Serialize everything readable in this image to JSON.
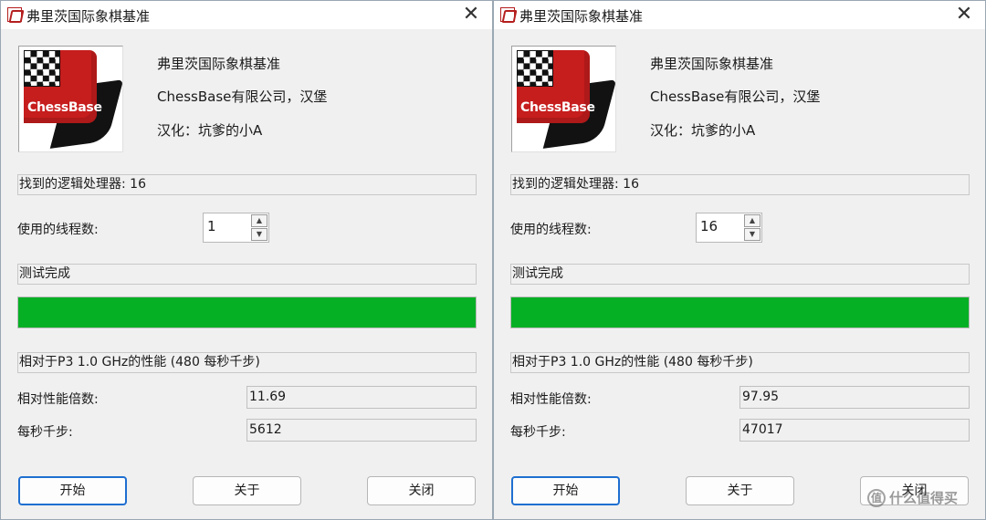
{
  "left": {
    "title": "弗里茨国际象棋基准",
    "close_glyph": "✕",
    "logo_word": "ChessBase",
    "info": [
      "弗里茨国际象棋基准",
      "ChessBase有限公司，汉堡",
      "汉化：坑爹的小A"
    ],
    "processors_text": "找到的逻辑处理器: 16",
    "threads_label": "使用的线程数:",
    "threads_value": "1",
    "status_text": "测试完成",
    "progress": 1.0,
    "perf_text": "相对于P3 1.0 GHz的性能 (480 每秒千步)",
    "factor_label": "相对性能倍数:",
    "factor_value": "11.69",
    "knps_label": "每秒千步:",
    "knps_value": "5612",
    "buttons": {
      "start": "开始",
      "about": "关于",
      "close": "关闭"
    }
  },
  "right": {
    "title": "弗里茨国际象棋基准",
    "close_glyph": "✕",
    "logo_word": "ChessBase",
    "info": [
      "弗里茨国际象棋基准",
      "ChessBase有限公司，汉堡",
      "汉化：坑爹的小A"
    ],
    "processors_text": "找到的逻辑处理器: 16",
    "threads_label": "使用的线程数:",
    "threads_value": "16",
    "status_text": "测试完成",
    "progress": 1.0,
    "perf_text": "相对于P3 1.0 GHz的性能 (480 每秒千步)",
    "factor_label": "相对性能倍数:",
    "factor_value": "97.95",
    "knps_label": "每秒千步:",
    "knps_value": "47017",
    "buttons": {
      "start": "开始",
      "about": "关于",
      "close": "关闭"
    }
  },
  "watermark": {
    "icon_glyph": "值",
    "text": "什么值得买"
  },
  "colors": {
    "progress_fill": "#06b025",
    "logo_red": "#c61d1d",
    "default_button_border": "#1f6fd1"
  },
  "icons": {
    "app": "chessbase-app-icon",
    "logo": "chessbase-logo-icon",
    "close": "close-icon"
  }
}
